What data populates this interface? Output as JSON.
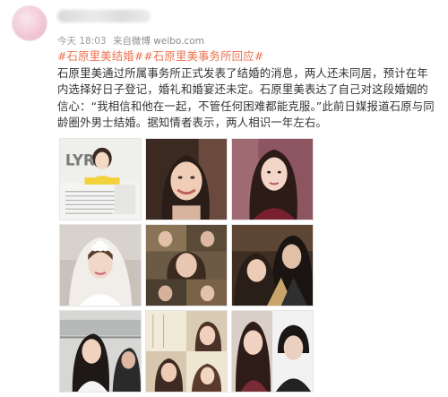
{
  "post": {
    "meta": {
      "time": "今天 18:03",
      "source_prefix": "来自",
      "source": "微博 weibo.com"
    },
    "hashtags": [
      "#石原里美结婚#",
      "#石原里美事务所回应#"
    ],
    "body": "石原里美通过所属事务所正式发表了结婚的消息，两人还未同居，预计在年内选择好日子登记，婚礼和婚宴还未定。石原里美表达了自己对这段婚姻的信心：“我相信和他在一起，不管任何困难都能克服。”此前日媒报道石原与同龄圈外男士结婚。据知情者表示，两人相识一年左右。",
    "photos": [
      {
        "icon": "magazine-page-photo",
        "caption_title": "LYRIC"
      },
      {
        "icon": "smiling-woman-photo"
      },
      {
        "icon": "portrait-woman-photo"
      },
      {
        "icon": "bride-veil-photo"
      },
      {
        "icon": "drama-stills-collage-photo"
      },
      {
        "icon": "couple-photo"
      },
      {
        "icon": "subway-scene-photo"
      },
      {
        "icon": "window-stills-collage-photo"
      },
      {
        "icon": "woman-and-man-photo"
      }
    ]
  },
  "colors": {
    "hashtag": "#eb7350",
    "text": "#333333",
    "meta": "#999999"
  }
}
